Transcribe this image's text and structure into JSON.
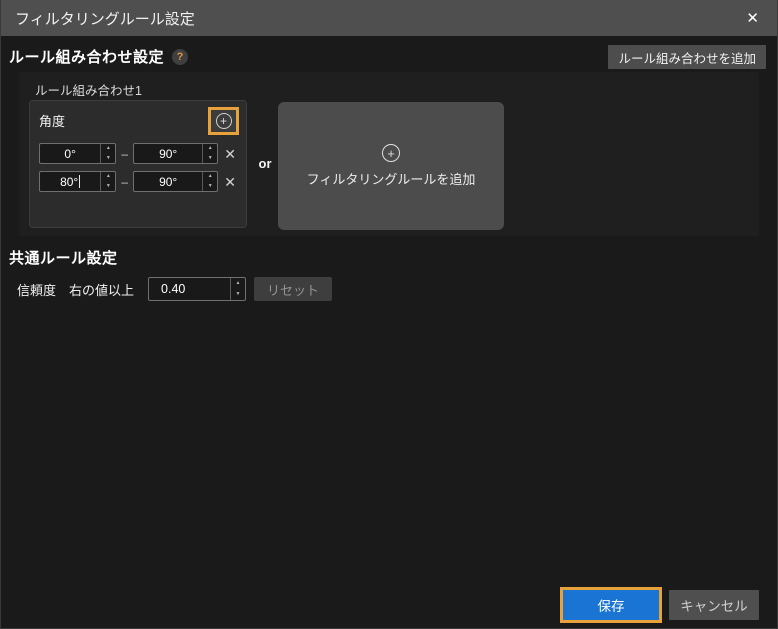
{
  "dialog": {
    "title": "フィルタリングルール設定"
  },
  "icons": {
    "close": "✕",
    "help": "?",
    "plus": "+",
    "spin_up": "▲",
    "spin_down": "▼",
    "remove": "✕",
    "range_dash": "–"
  },
  "colors": {
    "accent_orange": "#e8a23c",
    "save_blue": "#1a74d4",
    "titlebar_gray": "#4f4f4f",
    "card_gray": "#2c2c2c",
    "add_card_gray": "#4c4c4c"
  },
  "rule_section": {
    "title": "ルール組み合わせ設定",
    "add_combination_button": "ルール組み合わせを追加",
    "combination_label": "ルール組み合わせ1",
    "or_label": "or",
    "angle_card": {
      "title": "角度",
      "rows": [
        {
          "min": "0°",
          "max": "90°"
        },
        {
          "min": "80°",
          "max": "90°"
        }
      ]
    },
    "add_rule_label": "フィルタリングルールを追加"
  },
  "common_section": {
    "title": "共通ルール設定",
    "confidence_label": "信頼度",
    "mode_label": "右の値以上",
    "confidence_value": "0.40",
    "reset_button": "リセット"
  },
  "footer": {
    "save": "保存",
    "cancel": "キャンセル"
  }
}
